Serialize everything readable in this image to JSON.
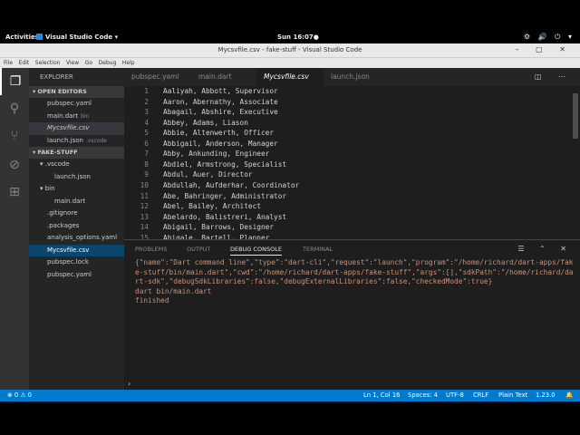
{
  "system": {
    "activities": "Activities",
    "app_menu": "Visual Studio Code ▾",
    "clock": "Sun 16:07●",
    "tray": "⚙ 🔊 ⏻ ▾"
  },
  "window": {
    "title": "Mycsvfile.csv - fake-stuff - Visual Studio Code",
    "controls": "– ▢ ✕"
  },
  "menu": [
    "File",
    "Edit",
    "Selection",
    "View",
    "Go",
    "Debug",
    "Help"
  ],
  "activity_bar": {
    "explorer": "❐",
    "search": "⚲",
    "scm": "⑂",
    "debug": "⊘",
    "extensions": "⊞"
  },
  "sidebar": {
    "header": "EXPLORER",
    "open_editors": {
      "title": "▾ OPEN EDITORS",
      "items": [
        {
          "name": "pubspec.yaml",
          "hint": ""
        },
        {
          "name": "main.dart",
          "hint": "bin"
        },
        {
          "name": "Mycsvfile.csv",
          "hint": ""
        },
        {
          "name": "launch.json",
          "hint": ".vscode"
        }
      ]
    },
    "project": {
      "title": "▾ FAKE-STUFF",
      "items": [
        {
          "name": "▾ .vscode"
        },
        {
          "name": "launch.json"
        },
        {
          "name": "▾ bin"
        },
        {
          "name": "main.dart"
        },
        {
          "name": ".gitignore"
        },
        {
          "name": ".packages"
        },
        {
          "name": "analysis_options.yaml"
        },
        {
          "name": "Mycsvfile.csv"
        },
        {
          "name": "pubspec.lock"
        },
        {
          "name": "pubspec.yaml"
        }
      ]
    }
  },
  "tabs": [
    {
      "label": "pubspec.yaml"
    },
    {
      "label": "main.dart"
    },
    {
      "label": "Mycsvfile.csv"
    },
    {
      "label": "launch.json"
    }
  ],
  "editor_tools": "◫ ⋯",
  "editor": {
    "lines": [
      {
        "n": "1",
        "t": "Aaliyah, Abbott, Supervisor"
      },
      {
        "n": "2",
        "t": "Aaron, Abernathy, Associate"
      },
      {
        "n": "3",
        "t": "Abagail, Abshire, Executive"
      },
      {
        "n": "4",
        "t": "Abbey, Adams, Liason"
      },
      {
        "n": "5",
        "t": "Abbie, Altenwerth, Officer"
      },
      {
        "n": "6",
        "t": "Abbigail, Anderson, Manager"
      },
      {
        "n": "7",
        "t": "Abby, Ankunding, Engineer"
      },
      {
        "n": "8",
        "t": "Abdiel, Armstrong, Specialist"
      },
      {
        "n": "9",
        "t": "Abdul, Auer, Director"
      },
      {
        "n": "10",
        "t": "Abdullah, Aufderhar, Coordinator"
      },
      {
        "n": "11",
        "t": "Abe, Bahringer, Administrator"
      },
      {
        "n": "12",
        "t": "Abel, Bailey, Architect"
      },
      {
        "n": "13",
        "t": "Abelardo, Balistreri, Analyst"
      },
      {
        "n": "14",
        "t": "Abigail, Barrows, Designer"
      },
      {
        "n": "15",
        "t": "Abigale, Bartell, Planner"
      }
    ]
  },
  "panel": {
    "tabs": [
      "PROBLEMS",
      "OUTPUT",
      "DEBUG CONSOLE",
      "TERMINAL"
    ],
    "tools": "☰ ⌃ ✕",
    "console_lines": [
      "{\"name\":\"Dart command line\",\"type\":\"dart-cli\",\"request\":\"launch\",\"program\":\"/home/richard/dart-apps/fake-stuff/bin/main.dart\",\"cwd\":\"/home/richard/dart-apps/fake-stuff\",\"args\":[],\"sdkPath\":\"/home/richard/dart-sdk\",\"debugSdkLibraries\":false,\"debugExternalLibraries\":false,\"checkedMode\":true}",
      "dart bin/main.dart",
      "finished"
    ],
    "prompt": "›"
  },
  "status": {
    "problems": "⊗ 0 ⚠ 0",
    "position": "Ln 1, Col 16",
    "spaces": "Spaces: 4",
    "encoding": "UTF-8",
    "eol": "CRLF",
    "language": "Plain Text",
    "version": "1.23.0",
    "bell": "🔔"
  }
}
